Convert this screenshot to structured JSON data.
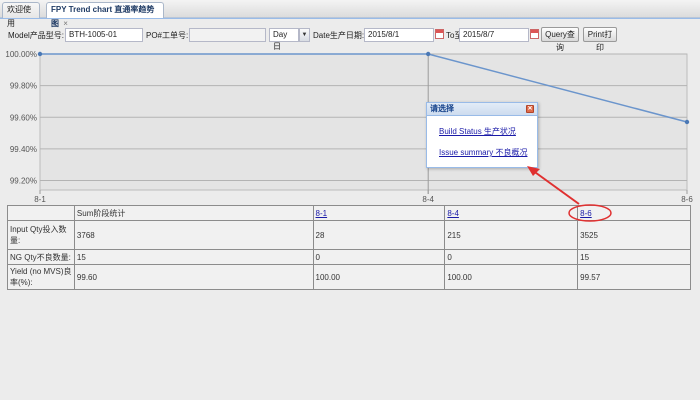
{
  "tabs": [
    {
      "label": "欢迎使用"
    },
    {
      "label": "FPY Trend chart 直通率趋势图",
      "close": "×"
    }
  ],
  "filter": {
    "model_label": "Model产品型号:",
    "model_value": "BTH-1005-01",
    "po_label": "PO#工单号:",
    "po_value": "",
    "period_value": "Day日",
    "date_label": "Date生产日期:",
    "date_from": "2015/8/1",
    "to_label": "To至",
    "date_to": "2015/8/7",
    "query_label": "Query查询",
    "print_label": "Print打印"
  },
  "chart_data": {
    "type": "line",
    "x": [
      "8-1",
      "8-4",
      "8-6"
    ],
    "series": [
      {
        "values": [
          100.0,
          100.0,
          99.57
        ]
      }
    ],
    "yticks": [
      "100.00%",
      "99.80%",
      "99.60%",
      "99.40%",
      "99.20%"
    ],
    "ylim": [
      99.14,
      100.0
    ],
    "line_color": "#6b95cc",
    "point_color": "#4a78b5",
    "grid": true
  },
  "popup": {
    "title": "请选择",
    "link1": "Build Status 生产状况",
    "link2": "Issue summary 不良概况"
  },
  "table": {
    "header": [
      "",
      "Sum阶段统计",
      "8-1",
      "8-4",
      "8-6"
    ],
    "rows": [
      {
        "label": "Input Qty投入数量:",
        "values": [
          "3768",
          "28",
          "215",
          "3525"
        ]
      },
      {
        "label": "NG Qty不良数量:",
        "values": [
          "15",
          "0",
          "0",
          "15"
        ]
      },
      {
        "label": "Yield (no MVS)良率(%):",
        "values": [
          "99.60",
          "100.00",
          "100.00",
          "99.57"
        ]
      }
    ]
  },
  "colors": {
    "annotation": "#e03030"
  }
}
